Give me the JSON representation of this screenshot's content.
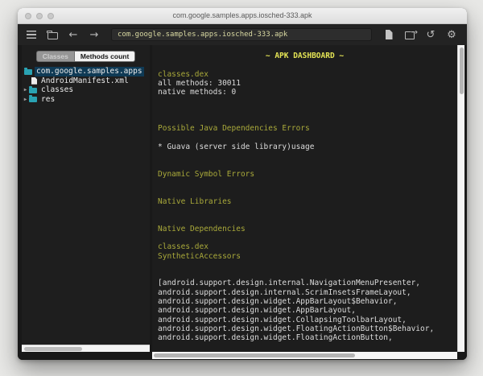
{
  "window": {
    "title": "com.google.samples.apps.iosched-333.apk",
    "toolbar": {
      "address": "com.google.samples.apps.iosched-333.apk",
      "icons": [
        "menu-icon",
        "open-folder-icon",
        "back-arrow-icon",
        "forward-arrow-icon",
        "document-icon",
        "export-icon",
        "history-icon",
        "gear-icon"
      ],
      "history_glyph": "↺",
      "gear_glyph": "⚙",
      "back_glyph": "←",
      "forward_glyph": "→"
    },
    "tabs": [
      {
        "label": "Classes",
        "selected": true
      },
      {
        "label": "Methods count",
        "selected": false
      }
    ],
    "tree": {
      "items": [
        {
          "label": "com.google.samples.apps",
          "type": "folder",
          "selected": true,
          "expander": false,
          "indent": 0
        },
        {
          "label": "AndroidManifest.xml",
          "type": "file",
          "selected": false,
          "expander": false,
          "indent": 1
        },
        {
          "label": "classes",
          "type": "folder",
          "selected": false,
          "expander": true,
          "indent": 0
        },
        {
          "label": "res",
          "type": "folder",
          "selected": false,
          "expander": true,
          "indent": 0
        }
      ],
      "expander_glyph": "▶"
    },
    "dashboard": {
      "lines": [
        {
          "text": "~ APK DASHBOARD ~",
          "style": "title"
        },
        {
          "text": "",
          "style": "blank"
        },
        {
          "text": "classes.dex",
          "style": "header"
        },
        {
          "text": "all methods: 30011",
          "style": "text"
        },
        {
          "text": "native methods: 0",
          "style": "text"
        },
        {
          "text": "",
          "style": "blank"
        },
        {
          "text": "",
          "style": "blank"
        },
        {
          "text": "",
          "style": "blank"
        },
        {
          "text": "Possible Java Dependencies Errors",
          "style": "header"
        },
        {
          "text": "",
          "style": "blank"
        },
        {
          "text": "* Guava (server side library)usage",
          "style": "text"
        },
        {
          "text": "",
          "style": "blank"
        },
        {
          "text": "",
          "style": "blank"
        },
        {
          "text": "Dynamic Symbol Errors",
          "style": "header"
        },
        {
          "text": "",
          "style": "blank"
        },
        {
          "text": "",
          "style": "blank"
        },
        {
          "text": "Native Libraries",
          "style": "header"
        },
        {
          "text": "",
          "style": "blank"
        },
        {
          "text": "",
          "style": "blank"
        },
        {
          "text": "Native Dependencies",
          "style": "header"
        },
        {
          "text": "",
          "style": "blank"
        },
        {
          "text": "classes.dex",
          "style": "header"
        },
        {
          "text": "SyntheticAccessors",
          "style": "header"
        },
        {
          "text": "",
          "style": "blank"
        },
        {
          "text": "",
          "style": "blank"
        },
        {
          "text": "[android.support.design.internal.NavigationMenuPresenter,",
          "style": "text"
        },
        {
          "text": "android.support.design.internal.ScrimInsetsFrameLayout,",
          "style": "text"
        },
        {
          "text": "android.support.design.widget.AppBarLayout$Behavior,",
          "style": "text"
        },
        {
          "text": "android.support.design.widget.AppBarLayout,",
          "style": "text"
        },
        {
          "text": "android.support.design.widget.CollapsingToolbarLayout,",
          "style": "text"
        },
        {
          "text": "android.support.design.widget.FloatingActionButton$Behavior,",
          "style": "text"
        },
        {
          "text": "android.support.design.widget.FloatingActionButton,",
          "style": "text"
        }
      ]
    },
    "colors": {
      "accent_yellow": "#e4e455",
      "header_olive": "#a9a93a",
      "body_text": "#dcdcdc",
      "folder_teal": "#2aa3b3",
      "selection_navy": "#0f3a55",
      "address_text": "#d9d9a2",
      "panel_bg": "#1d1d1d"
    }
  }
}
